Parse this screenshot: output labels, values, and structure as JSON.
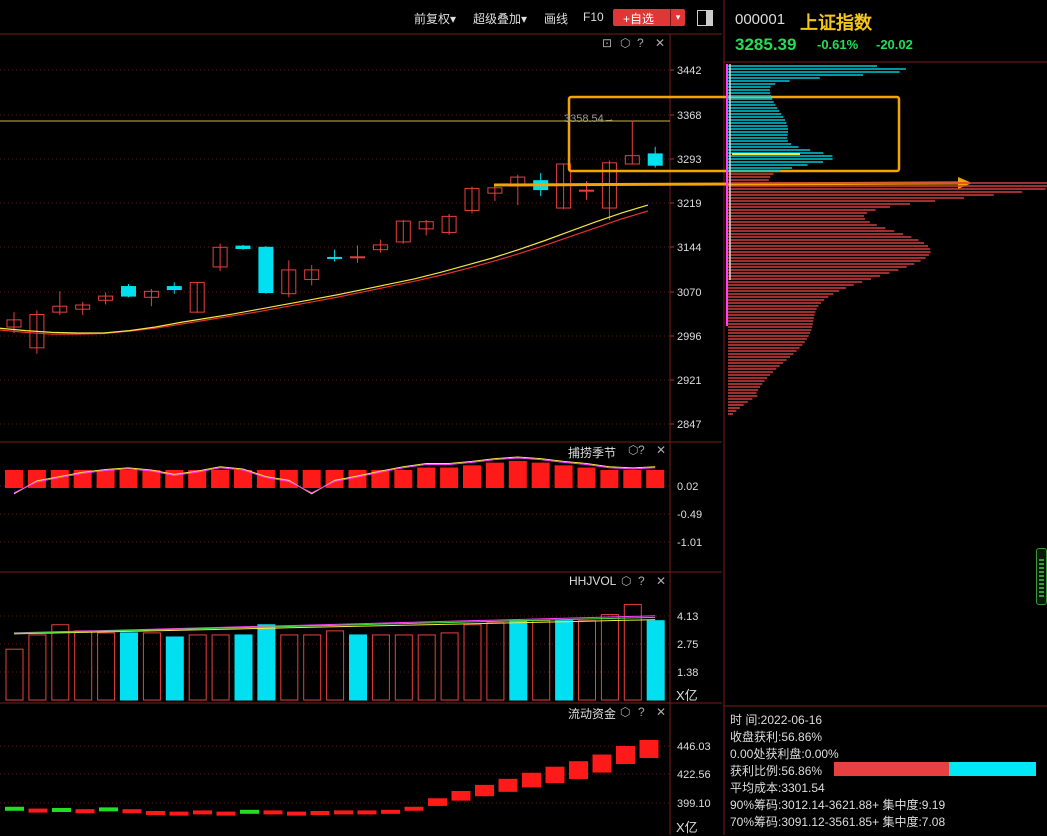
{
  "toolbar": {
    "adjust_label": "前复权▾",
    "overlay_label": "超级叠加▾",
    "draw_label": "画线",
    "f10_label": "F10",
    "favorite_label": "+自选",
    "dropdown_icon": "▾"
  },
  "stock": {
    "code": "000001",
    "name": "上证指数",
    "price": "3285.39",
    "change_pct": "-0.61%",
    "change_abs": "-20.02"
  },
  "colors": {
    "up": "#e84040",
    "down": "#00e0f0",
    "ma_fast": "#f5e642",
    "ma_slow": "#e83030",
    "accent": "#f5a300",
    "positive_text": "#22dd55"
  },
  "main_panel": {
    "y_ticks": [
      "3442",
      "3368",
      "3293",
      "3219",
      "3144",
      "3070",
      "2996",
      "2921",
      "2847"
    ],
    "marker_label": "3358.54→",
    "icons": [
      "lock-icon",
      "settings-icon",
      "help-icon"
    ]
  },
  "indicator1": {
    "name": "捕捞季节",
    "y_ticks": [
      "0.02",
      "-0.49",
      "-1.01"
    ]
  },
  "indicator2": {
    "name": "HHJVOL",
    "y_ticks": [
      "4.13",
      "2.75",
      "1.38"
    ],
    "unit": "X亿"
  },
  "indicator3": {
    "name": "流动资金",
    "y_ticks": [
      "446.03",
      "422.56",
      "399.10"
    ],
    "unit": "X亿"
  },
  "chip_info": {
    "time_line": "时 间:2022-06-16",
    "close_profit": "收盘获利:56.86%",
    "zero_profit": "0.00处获利盘:0.00%",
    "profit_ratio_label": "获利比例:56.86%",
    "profit_ratio": 0.5686,
    "avg_cost": "平均成本:3301.54",
    "chip90": "90%筹码:3012.14-3621.88+ 集中度:9.19",
    "chip70": "70%筹码:3091.12-3561.85+ 集中度:7.08"
  },
  "chart_data": {
    "type": "candlestick",
    "title": "上证指数",
    "y_range": [
      2847,
      3442
    ],
    "candles": [
      {
        "o": 3010,
        "c": 3022,
        "h": 3035,
        "l": 3000
      },
      {
        "o": 2975,
        "c": 3031,
        "h": 3038,
        "l": 2965
      },
      {
        "o": 3035,
        "c": 3045,
        "h": 3070,
        "l": 3030
      },
      {
        "o": 3040,
        "c": 3047,
        "h": 3052,
        "l": 3030
      },
      {
        "o": 3055,
        "c": 3062,
        "h": 3068,
        "l": 3048
      },
      {
        "o": 3078,
        "c": 3062,
        "h": 3082,
        "l": 3060
      },
      {
        "o": 3060,
        "c": 3070,
        "h": 3074,
        "l": 3045
      },
      {
        "o": 3078,
        "c": 3073,
        "h": 3085,
        "l": 3066
      },
      {
        "o": 3035,
        "c": 3085,
        "h": 3086,
        "l": 3034
      },
      {
        "o": 3111,
        "c": 3144,
        "h": 3150,
        "l": 3104
      },
      {
        "o": 3146,
        "c": 3142,
        "h": 3148,
        "l": 3140
      },
      {
        "o": 3144,
        "c": 3068,
        "h": 3146,
        "l": 3066
      },
      {
        "o": 3066,
        "c": 3106,
        "h": 3122,
        "l": 3060
      },
      {
        "o": 3090,
        "c": 3106,
        "h": 3114,
        "l": 3080
      },
      {
        "o": 3127,
        "c": 3126,
        "h": 3140,
        "l": 3120
      },
      {
        "o": 3128,
        "c": 3128,
        "h": 3147,
        "l": 3118
      },
      {
        "o": 3140,
        "c": 3148,
        "h": 3157,
        "l": 3135
      },
      {
        "o": 3153,
        "c": 3188,
        "h": 3190,
        "l": 3150
      },
      {
        "o": 3175,
        "c": 3187,
        "h": 3190,
        "l": 3164
      },
      {
        "o": 3169,
        "c": 3196,
        "h": 3200,
        "l": 3165
      },
      {
        "o": 3206,
        "c": 3243,
        "h": 3246,
        "l": 3201
      },
      {
        "o": 3235,
        "c": 3244,
        "h": 3249,
        "l": 3222
      },
      {
        "o": 3248,
        "c": 3262,
        "h": 3266,
        "l": 3215
      },
      {
        "o": 3256,
        "c": 3241,
        "h": 3269,
        "l": 3230
      },
      {
        "o": 3210,
        "c": 3284,
        "h": 3285,
        "l": 3208
      },
      {
        "o": 3240,
        "c": 3240,
        "h": 3255,
        "l": 3224
      },
      {
        "o": 3210,
        "c": 3286,
        "h": 3290,
        "l": 3190
      },
      {
        "o": 3284,
        "c": 3298,
        "h": 3357,
        "l": 3283
      },
      {
        "o": 3301,
        "c": 3282,
        "h": 3313,
        "l": 3278
      }
    ],
    "ma_fast": [
      3008,
      3004,
      3001,
      3000,
      3000,
      3004,
      3010,
      3018,
      3025,
      3032,
      3040,
      3048,
      3056,
      3064,
      3073,
      3082,
      3091,
      3102,
      3114,
      3126,
      3140,
      3155,
      3171,
      3187,
      3202,
      3215
    ],
    "ma_slow": [
      3005,
      3001,
      2998,
      2998,
      2999,
      3003,
      3008,
      3015,
      3022,
      3029,
      3036,
      3044,
      3052,
      3060,
      3069,
      3078,
      3087,
      3097,
      3108,
      3120,
      3133,
      3147,
      3162,
      3177,
      3192,
      3205
    ],
    "indicator1_values": [
      -0.05,
      0.04,
      0.12,
      0.2,
      0.25,
      0.28,
      0.24,
      0.16,
      0.22,
      0.3,
      0.26,
      0.12,
      0.05,
      -0.05,
      0.05,
      0.13,
      0.22,
      0.3,
      0.36,
      0.36,
      0.4,
      0.45,
      0.48,
      0.45,
      0.4,
      0.36,
      0.3,
      0.28,
      0.3
    ],
    "volume_values": [
      2.5,
      3.2,
      3.7,
      3.4,
      3.3,
      3.3,
      3.3,
      3.1,
      3.2,
      3.2,
      3.2,
      3.7,
      3.2,
      3.2,
      3.4,
      3.2,
      3.2,
      3.2,
      3.2,
      3.3,
      3.7,
      3.8,
      3.9,
      3.9,
      3.9,
      3.9,
      4.2,
      4.7,
      3.9
    ],
    "volume_down": [
      false,
      false,
      false,
      false,
      false,
      true,
      false,
      true,
      false,
      false,
      true,
      true,
      false,
      false,
      false,
      true,
      false,
      false,
      false,
      false,
      false,
      false,
      true,
      false,
      true,
      false,
      false,
      false,
      true
    ],
    "fund_flow": [
      396,
      394.5,
      395,
      394,
      395.5,
      394,
      392.5,
      392,
      393,
      392,
      393.5,
      393,
      392,
      392.5,
      393,
      393,
      393.5,
      396,
      403,
      409,
      414,
      419,
      424,
      429,
      433.5,
      439,
      446,
      451
    ],
    "fund_flow_down": [
      true,
      false,
      true,
      false,
      true,
      false,
      false,
      false,
      false,
      false,
      true,
      false,
      false,
      false,
      false,
      false,
      false,
      false,
      false,
      false,
      false,
      false,
      false,
      false,
      false,
      false,
      false,
      false
    ]
  }
}
